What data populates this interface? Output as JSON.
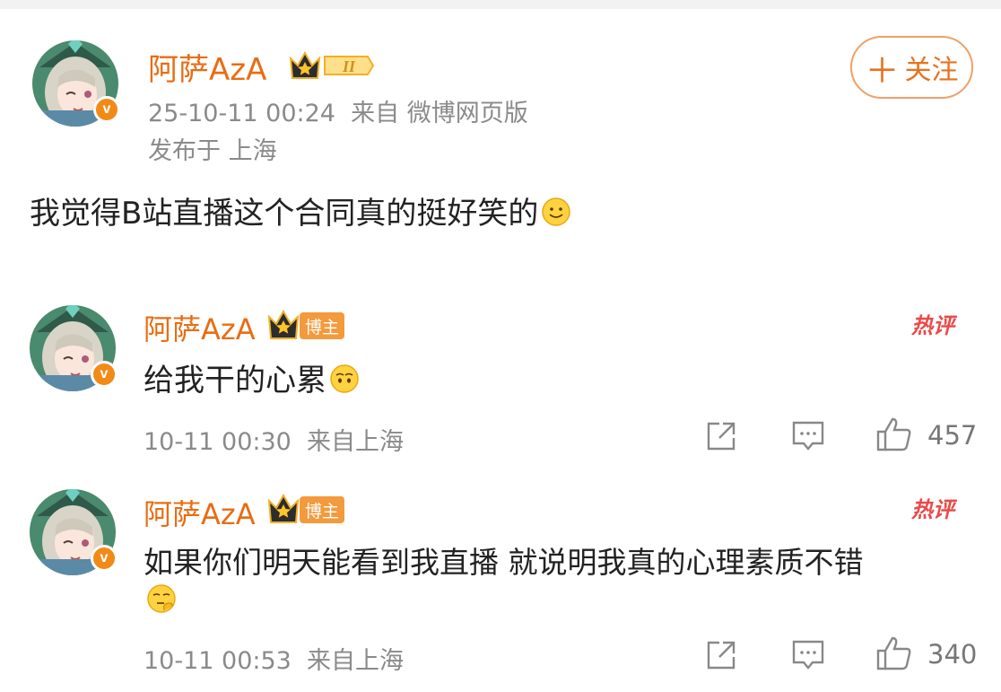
{
  "post": {
    "author": "阿萨AzA",
    "level_badge": "II",
    "time": "25-10-11 00:24",
    "source": "来自 微博网页版",
    "location": "发布于 上海",
    "text": "我觉得B站直播这个合同真的挺好笑的",
    "emoji": "smile-emoji",
    "follow_plus": "＋",
    "follow_label": "关注"
  },
  "comments": [
    {
      "author": "阿萨AzA",
      "role_badge": "博主",
      "hot_label": "热评",
      "text": "给我干的心累",
      "emoji": "tired-emoji",
      "time": "10-11 00:30",
      "location": "来自上海",
      "likes": "457"
    },
    {
      "author": "阿萨AzA",
      "role_badge": "博主",
      "hot_label": "热评",
      "text": "如果你们明天能看到我直播 就说明我真的心理素质不错",
      "emoji": "thinking-emoji",
      "time": "10-11 00:53",
      "location": "来自上海",
      "likes": "340"
    }
  ],
  "colors": {
    "accent": "#e86d13",
    "verified": "#f28a17",
    "hot": "#e94a4a",
    "muted": "#8a8a8a"
  }
}
